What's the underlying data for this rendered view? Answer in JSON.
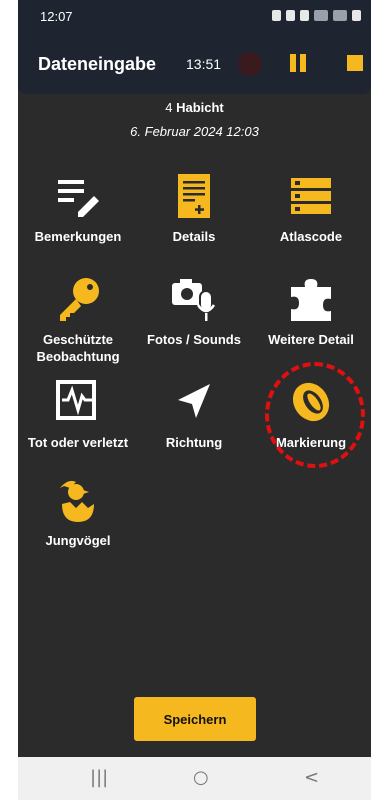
{
  "status_bar": {
    "time": "12:07"
  },
  "app_bar": {
    "title": "Dateneingabe",
    "timer": "13:51"
  },
  "header": {
    "count": "4",
    "species": "Habicht",
    "datetime": "6. Februar 2024 12:03"
  },
  "tiles": [
    {
      "label": "Bemerkungen",
      "icon": "notes-edit-icon"
    },
    {
      "label": "Details",
      "icon": "document-add-icon"
    },
    {
      "label": "Atlascode",
      "icon": "list-icon"
    },
    {
      "label": "Geschützte",
      "label2": "Beobachtung",
      "icon": "key-icon"
    },
    {
      "label": "Fotos / Sounds",
      "icon": "camera-mic-icon"
    },
    {
      "label": "Weitere Detail",
      "icon": "puzzle-icon"
    },
    {
      "label": "Tot oder verletzt",
      "icon": "vital-signs-icon"
    },
    {
      "label": "Richtung",
      "icon": "direction-arrow-icon"
    },
    {
      "label": "Markierung",
      "icon": "ring-icon"
    },
    {
      "label": "Jungvögel",
      "icon": "hatching-egg-icon"
    }
  ],
  "save_button": {
    "label": "Speichern"
  },
  "nav": {
    "recents": "|||",
    "home": "○",
    "back": "<"
  },
  "colors": {
    "accent": "#f6b81f",
    "background": "#2b2b2b",
    "appbar": "#1f2530",
    "annotation": "#e01010"
  }
}
